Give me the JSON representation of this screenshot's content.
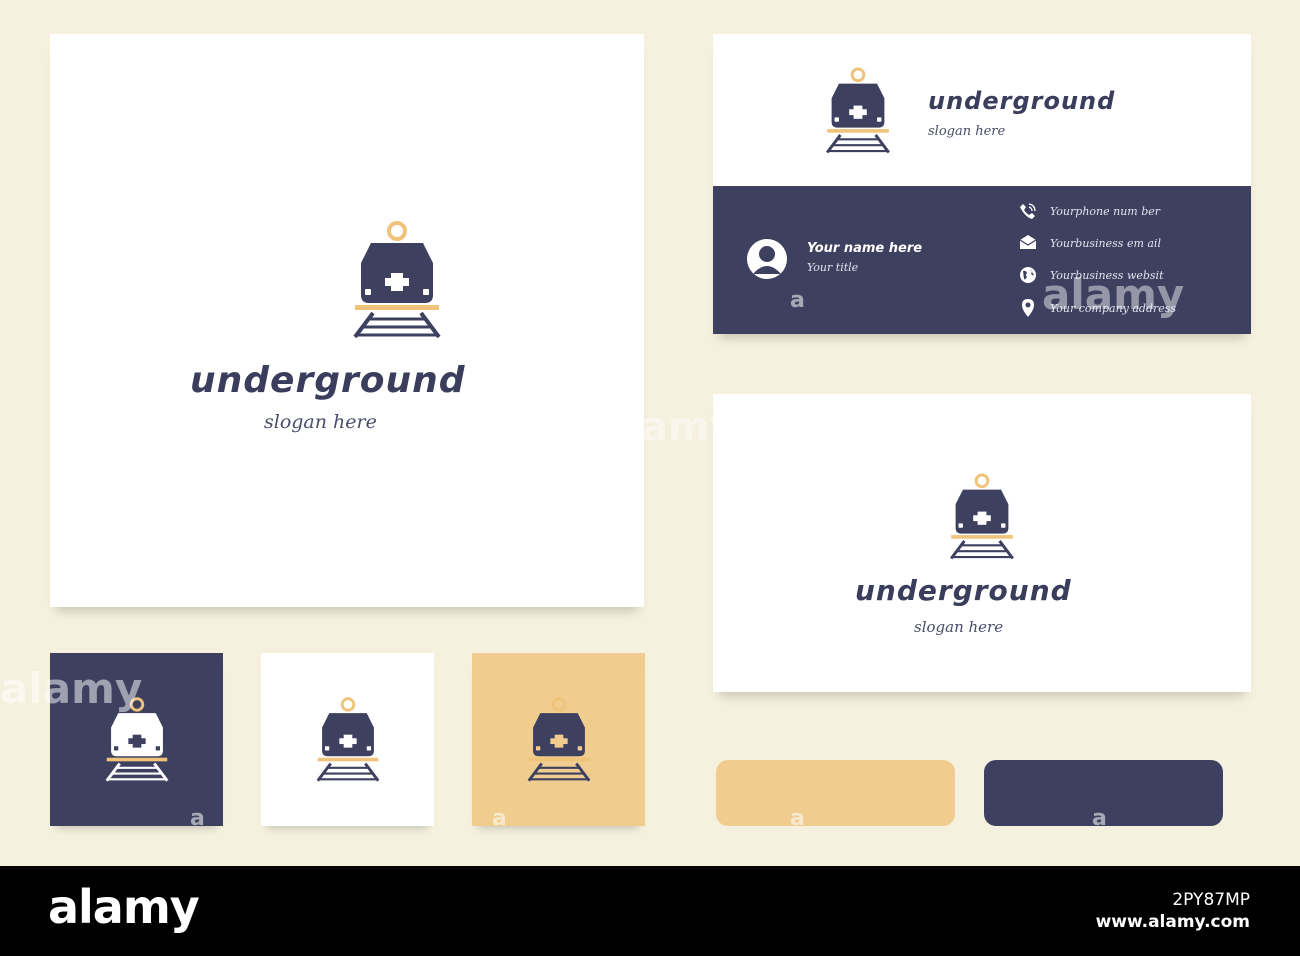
{
  "brand": {
    "name": "underground",
    "slogan": "slogan here"
  },
  "business_card": {
    "name": "Your name here",
    "title": "Your title",
    "contacts": [
      {
        "icon": "phone-icon",
        "text": "Yourphone num ber"
      },
      {
        "icon": "envelope-icon",
        "text": "Yourbusiness em ail"
      },
      {
        "icon": "globe-icon",
        "text": "Yourbusiness websit"
      },
      {
        "icon": "location-pin-icon",
        "text": "Your company address"
      }
    ]
  },
  "colors": {
    "navy": "#3e4060",
    "gold": "#f0cd8f",
    "background": "#f5f1de",
    "white": "#ffffff"
  },
  "watermark": {
    "brand": "alamy",
    "letter": "a",
    "image_id": "2PY87MP",
    "site": "www.alamy.com"
  }
}
